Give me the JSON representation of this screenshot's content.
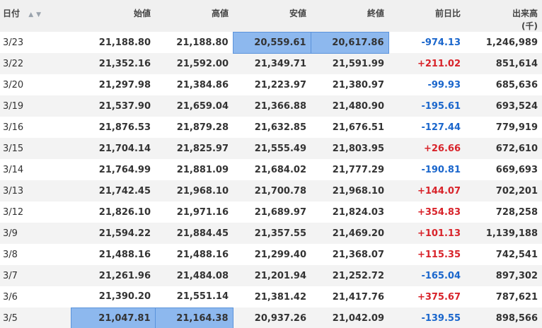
{
  "header": {
    "date": "日付",
    "open": "始値",
    "high": "高値",
    "low": "安値",
    "close": "終値",
    "change": "前日比",
    "volume": "出来高",
    "volume_unit": "(千)",
    "sort_asc_icon": "▲",
    "sort_desc_icon": "▼"
  },
  "colors": {
    "highlight": "#8db8ee",
    "negative": "#1a66cc",
    "positive": "#d8232a"
  },
  "rows": [
    {
      "date": "3/23",
      "open": "21,188.80",
      "high": "21,188.80",
      "low": "20,559.61",
      "close": "20,617.86",
      "change": "-974.13",
      "volume": "1,246,989",
      "hl": [
        "low",
        "close"
      ]
    },
    {
      "date": "3/22",
      "open": "21,352.16",
      "high": "21,592.00",
      "low": "21,349.71",
      "close": "21,591.99",
      "change": "+211.02",
      "volume": "851,614",
      "hl": []
    },
    {
      "date": "3/20",
      "open": "21,297.98",
      "high": "21,384.86",
      "low": "21,223.97",
      "close": "21,380.97",
      "change": "-99.93",
      "volume": "685,636",
      "hl": []
    },
    {
      "date": "3/19",
      "open": "21,537.90",
      "high": "21,659.04",
      "low": "21,366.88",
      "close": "21,480.90",
      "change": "-195.61",
      "volume": "693,524",
      "hl": []
    },
    {
      "date": "3/16",
      "open": "21,876.53",
      "high": "21,879.28",
      "low": "21,632.85",
      "close": "21,676.51",
      "change": "-127.44",
      "volume": "779,919",
      "hl": []
    },
    {
      "date": "3/15",
      "open": "21,704.14",
      "high": "21,825.97",
      "low": "21,555.49",
      "close": "21,803.95",
      "change": "+26.66",
      "volume": "672,610",
      "hl": []
    },
    {
      "date": "3/14",
      "open": "21,764.99",
      "high": "21,881.09",
      "low": "21,684.02",
      "close": "21,777.29",
      "change": "-190.81",
      "volume": "669,693",
      "hl": []
    },
    {
      "date": "3/13",
      "open": "21,742.45",
      "high": "21,968.10",
      "low": "21,700.78",
      "close": "21,968.10",
      "change": "+144.07",
      "volume": "702,201",
      "hl": []
    },
    {
      "date": "3/12",
      "open": "21,826.10",
      "high": "21,971.16",
      "low": "21,689.97",
      "close": "21,824.03",
      "change": "+354.83",
      "volume": "728,258",
      "hl": []
    },
    {
      "date": "3/9",
      "open": "21,594.22",
      "high": "21,884.45",
      "low": "21,357.55",
      "close": "21,469.20",
      "change": "+101.13",
      "volume": "1,139,188",
      "hl": []
    },
    {
      "date": "3/8",
      "open": "21,488.16",
      "high": "21,488.16",
      "low": "21,299.40",
      "close": "21,368.07",
      "change": "+115.35",
      "volume": "742,541",
      "hl": []
    },
    {
      "date": "3/7",
      "open": "21,261.96",
      "high": "21,484.08",
      "low": "21,201.94",
      "close": "21,252.72",
      "change": "-165.04",
      "volume": "897,302",
      "hl": []
    },
    {
      "date": "3/6",
      "open": "21,390.20",
      "high": "21,551.14",
      "low": "21,381.42",
      "close": "21,417.76",
      "change": "+375.67",
      "volume": "787,621",
      "hl": []
    },
    {
      "date": "3/5",
      "open": "21,047.81",
      "high": "21,164.38",
      "low": "20,937.26",
      "close": "21,042.09",
      "change": "-139.55",
      "volume": "898,566",
      "hl": [
        "open",
        "high"
      ]
    }
  ]
}
